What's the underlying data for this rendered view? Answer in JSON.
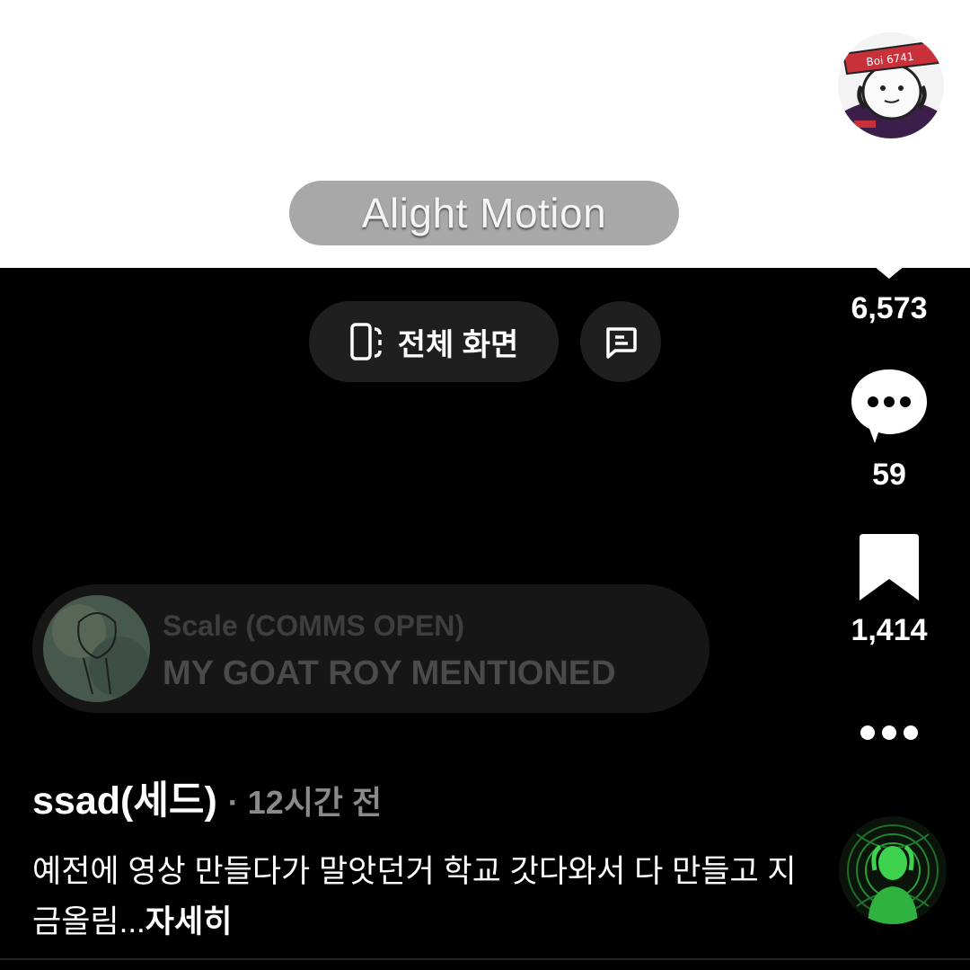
{
  "video": {
    "watermark": "Alight Motion",
    "fullscreen_label": "전체 화면"
  },
  "actions": {
    "likes": "6,573",
    "comments": "59",
    "saves": "1,414"
  },
  "mention": {
    "name": "Scale (COMMS OPEN)",
    "text": "MY GOAT ROY MENTIONED"
  },
  "post": {
    "author": "ssad(세드)",
    "time": "· 12시간 전",
    "description": "예전에 영상 만들다가 말앗던거 학교 갓다와서 다 만들고 지금올림",
    "ellipsis": "...",
    "more_label": "자세히"
  },
  "creator_avatar_text": "Boi 6741",
  "icons": {
    "fullscreen": "fullscreen-icon",
    "caption": "caption-icon",
    "like": "heart-icon",
    "comment": "comment-bubble-icon",
    "save": "bookmark-icon",
    "more": "more-dots-icon"
  },
  "colors": {
    "background": "#000000",
    "pill": "#1f1f1f",
    "muted_text": "#8a8a8a"
  }
}
